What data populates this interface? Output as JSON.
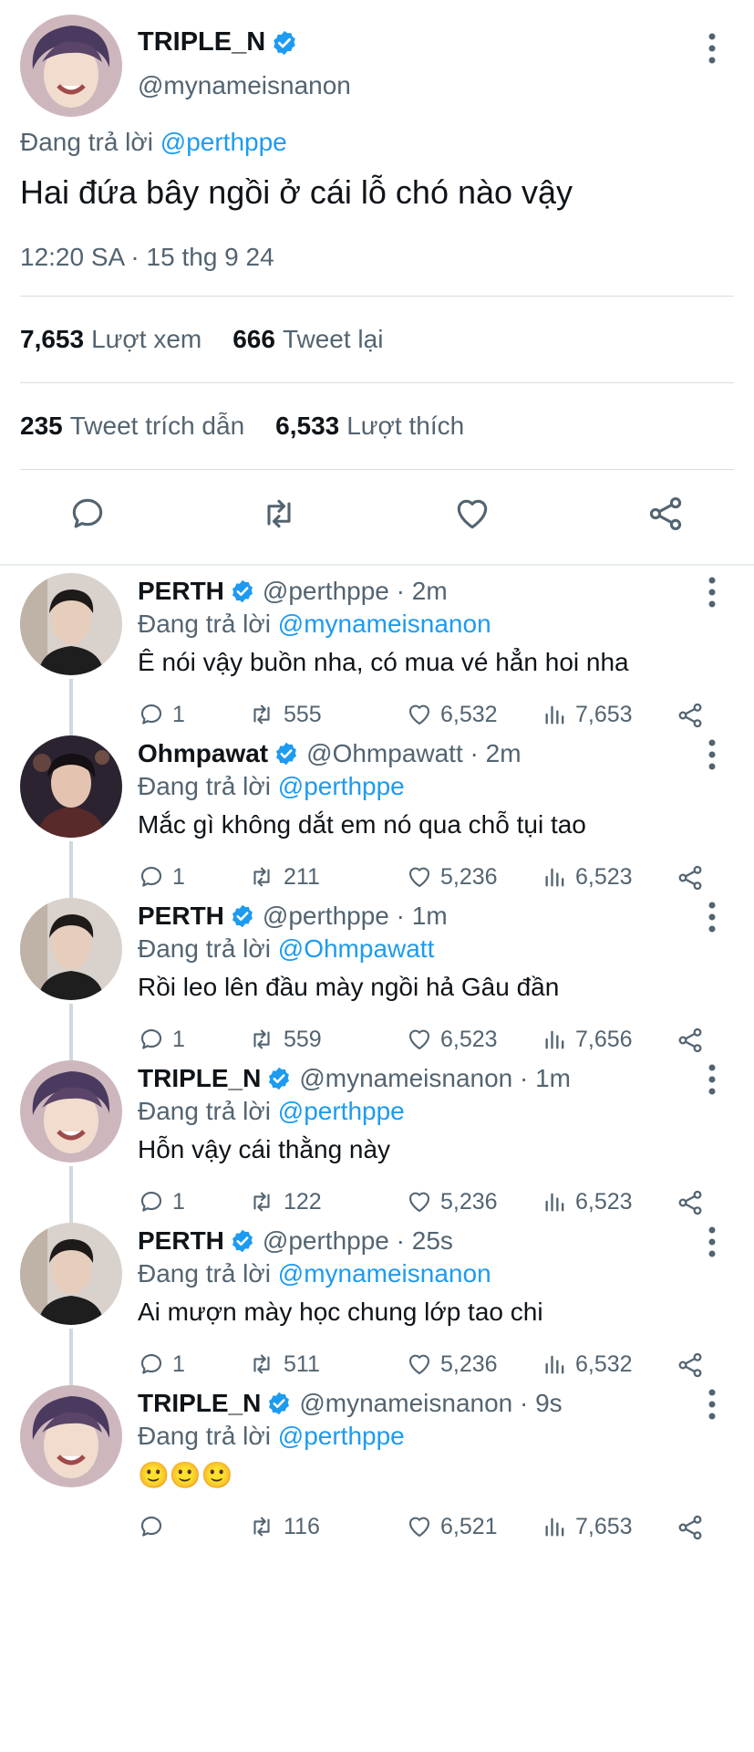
{
  "main_tweet": {
    "name": "TRIPLE_N",
    "handle": "@mynameisnanon",
    "replying_label": "Đang trả lời",
    "replying_to": "@perthppe",
    "text": "Hai đứa bây ngồi ở cái lỗ chó nào vậy",
    "timestamp": "12:20 SA · 15 thg 9 24",
    "views": "7,653",
    "views_label": "Lượt xem",
    "retweets": "666",
    "retweets_label": "Tweet lại",
    "quotes": "235",
    "quotes_label": "Tweet trích dẫn",
    "likes": "6,533",
    "likes_label": "Lượt thích"
  },
  "replies": [
    {
      "name": "PERTH",
      "handle": "@perthppe · 2m",
      "replying_label": "Đang trả lời",
      "replying_to": "@mynameisnanon",
      "text": "Ê nói vậy buồn nha, có mua vé hẳn hoi nha",
      "replies": "1",
      "retweets": "555",
      "likes": "6,532",
      "views": "7,653"
    },
    {
      "name": "Ohmpawat",
      "handle": "@Ohmpawatt · 2m",
      "replying_label": "Đang trả lời",
      "replying_to": "@perthppe",
      "text": "Mắc gì không dắt em nó qua chỗ tụi tao",
      "replies": "1",
      "retweets": "211",
      "likes": "5,236",
      "views": "6,523"
    },
    {
      "name": "PERTH",
      "handle": "@perthppe · 1m",
      "replying_label": "Đang trả lời",
      "replying_to": "@Ohmpawatt",
      "text": "Rồi leo lên đầu mày ngồi hả Gâu đần",
      "replies": "1",
      "retweets": "559",
      "likes": "6,523",
      "views": "7,656"
    },
    {
      "name": "TRIPLE_N",
      "handle": "@mynameisnanon · 1m",
      "replying_label": "Đang trả lời",
      "replying_to": "@perthppe",
      "text": "Hỗn vậy cái thằng này",
      "replies": "1",
      "retweets": "122",
      "likes": "5,236",
      "views": "6,523"
    },
    {
      "name": "PERTH",
      "handle": "@perthppe · 25s",
      "replying_label": "Đang trả lời",
      "replying_to": "@mynameisnanon",
      "text": "Ai mượn mày học chung lớp tao chi",
      "replies": "1",
      "retweets": "511",
      "likes": "5,236",
      "views": "6,532"
    },
    {
      "name": "TRIPLE_N",
      "handle": "@mynameisnanon · 9s",
      "replying_label": "Đang trả lời",
      "replying_to": "@perthppe",
      "text": "🙂🙂🙂",
      "replies": "",
      "retweets": "116",
      "likes": "6,521",
      "views": "7,653"
    }
  ],
  "colors": {
    "verified": "#1d9bf0",
    "link": "#1d9bf0",
    "secondary_text": "#536471",
    "primary_text": "#0f1419",
    "thread_line": "#cfd9de"
  },
  "icons": {
    "more": "more-vertical-icon",
    "verified": "verified-badge-icon",
    "reply": "reply-icon",
    "retweet": "retweet-icon",
    "like": "heart-icon",
    "views": "views-icon",
    "share": "share-icon"
  }
}
